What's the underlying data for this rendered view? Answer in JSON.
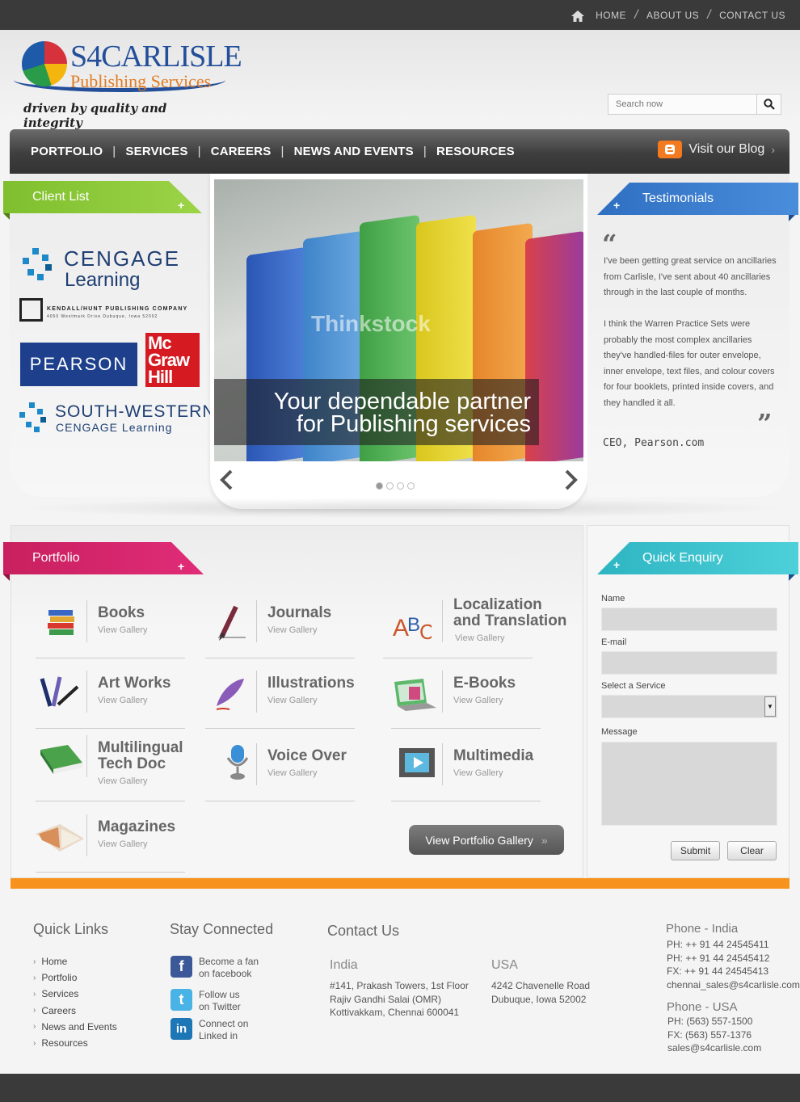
{
  "topnav": {
    "home": "HOME",
    "about": "ABOUT US",
    "contact": "CONTACT US"
  },
  "brand": {
    "name": "S4CARLISLE",
    "subtitle": "Publishing Services",
    "tagline": "driven by quality and integrity"
  },
  "search": {
    "placeholder": "Search now"
  },
  "mainnav": {
    "items": [
      "PORTFOLIO",
      "SERVICES",
      "CAREERS",
      "NEWS AND EVENTS",
      "RESOURCES"
    ],
    "blog": "Visit our Blog"
  },
  "clients": {
    "title": "Client List",
    "cengage": [
      "CENGAGE",
      "Learning"
    ],
    "kendall": [
      "KENDALL/HUNT PUBLISHING COMPANY",
      "4050 Westmark Drive        Dubuque, Iowa 52002"
    ],
    "pearson": "PEARSON",
    "mcgraw": [
      "Mc",
      "Graw",
      "Hill"
    ],
    "southwestern": [
      "SOUTH-WESTERN",
      "CENGAGE Learning"
    ]
  },
  "slider": {
    "watermark": "Thinkstock",
    "caption1": "Your dependable partner",
    "caption2": "for Publishing services"
  },
  "testimonials": {
    "title": "Testimonials",
    "p1": "I've been getting great service on ancillaries from Carlisle, I've sent about 40 ancillaries through in the last couple of months.",
    "p2": "I think the Warren Practice Sets were probably the most complex ancillaries they've handled-files for outer envelope, inner envelope, text files, and colour covers for four booklets, printed inside covers, and they handled it all.",
    "author": "CEO, Pearson.com"
  },
  "portfolio": {
    "title": "Portfolio",
    "view": "View Gallery",
    "books": "Books",
    "journals": "Journals",
    "localization": [
      "Localization",
      "and Translation"
    ],
    "artworks": "Art Works",
    "illustrations": "Illustrations",
    "ebooks": "E-Books",
    "multilingual": [
      "Multilingual",
      "Tech Doc"
    ],
    "voiceover": "Voice Over",
    "multimedia": "Multimedia",
    "magazines": "Magazines",
    "button": "View Portfolio Gallery"
  },
  "enquiry": {
    "title": "Quick Enquiry",
    "name": "Name",
    "email": "E-mail",
    "service": "Select a Service",
    "message": "Message",
    "submit": "Submit",
    "clear": "Clear"
  },
  "footer": {
    "quicklinks_title": "Quick Links",
    "quicklinks": [
      "Home",
      "Portfolio",
      "Services",
      "Careers",
      "News and Events",
      "Resources"
    ],
    "stay_title": "Stay Connected",
    "facebook": [
      "Become a fan",
      "on facebook"
    ],
    "twitter": [
      "Follow us",
      "on Twitter"
    ],
    "linkedin": [
      "Connect on",
      "Linked in"
    ],
    "contact_title": "Contact Us",
    "india_title": "India",
    "india_addr": [
      "#141, Prakash Towers, 1st Floor",
      "Rajiv Gandhi Salai (OMR)",
      "Kottivakkam, Chennai 600041"
    ],
    "usa_title": "USA",
    "usa_addr": [
      "4242 Chavenelle Road",
      "Dubuque, Iowa 52002"
    ],
    "phone_india_title": "Phone - India",
    "phone_india": [
      "PH: ++ 91 44 24545411",
      "PH: ++ 91 44 24545412",
      "FX: ++ 91 44 24545413",
      "chennai_sales@s4carlisle.com"
    ],
    "phone_usa_title": "Phone - USA",
    "phone_usa": [
      "PH: (563) 557-1500",
      "FX: (563) 557-1376",
      "sales@s4carlisle.com"
    ]
  },
  "colors": {
    "green": "#8cc63f",
    "blue": "#3a7fcf",
    "pink": "#d8256f",
    "teal": "#37c6d1",
    "orange": "#f7931d"
  }
}
